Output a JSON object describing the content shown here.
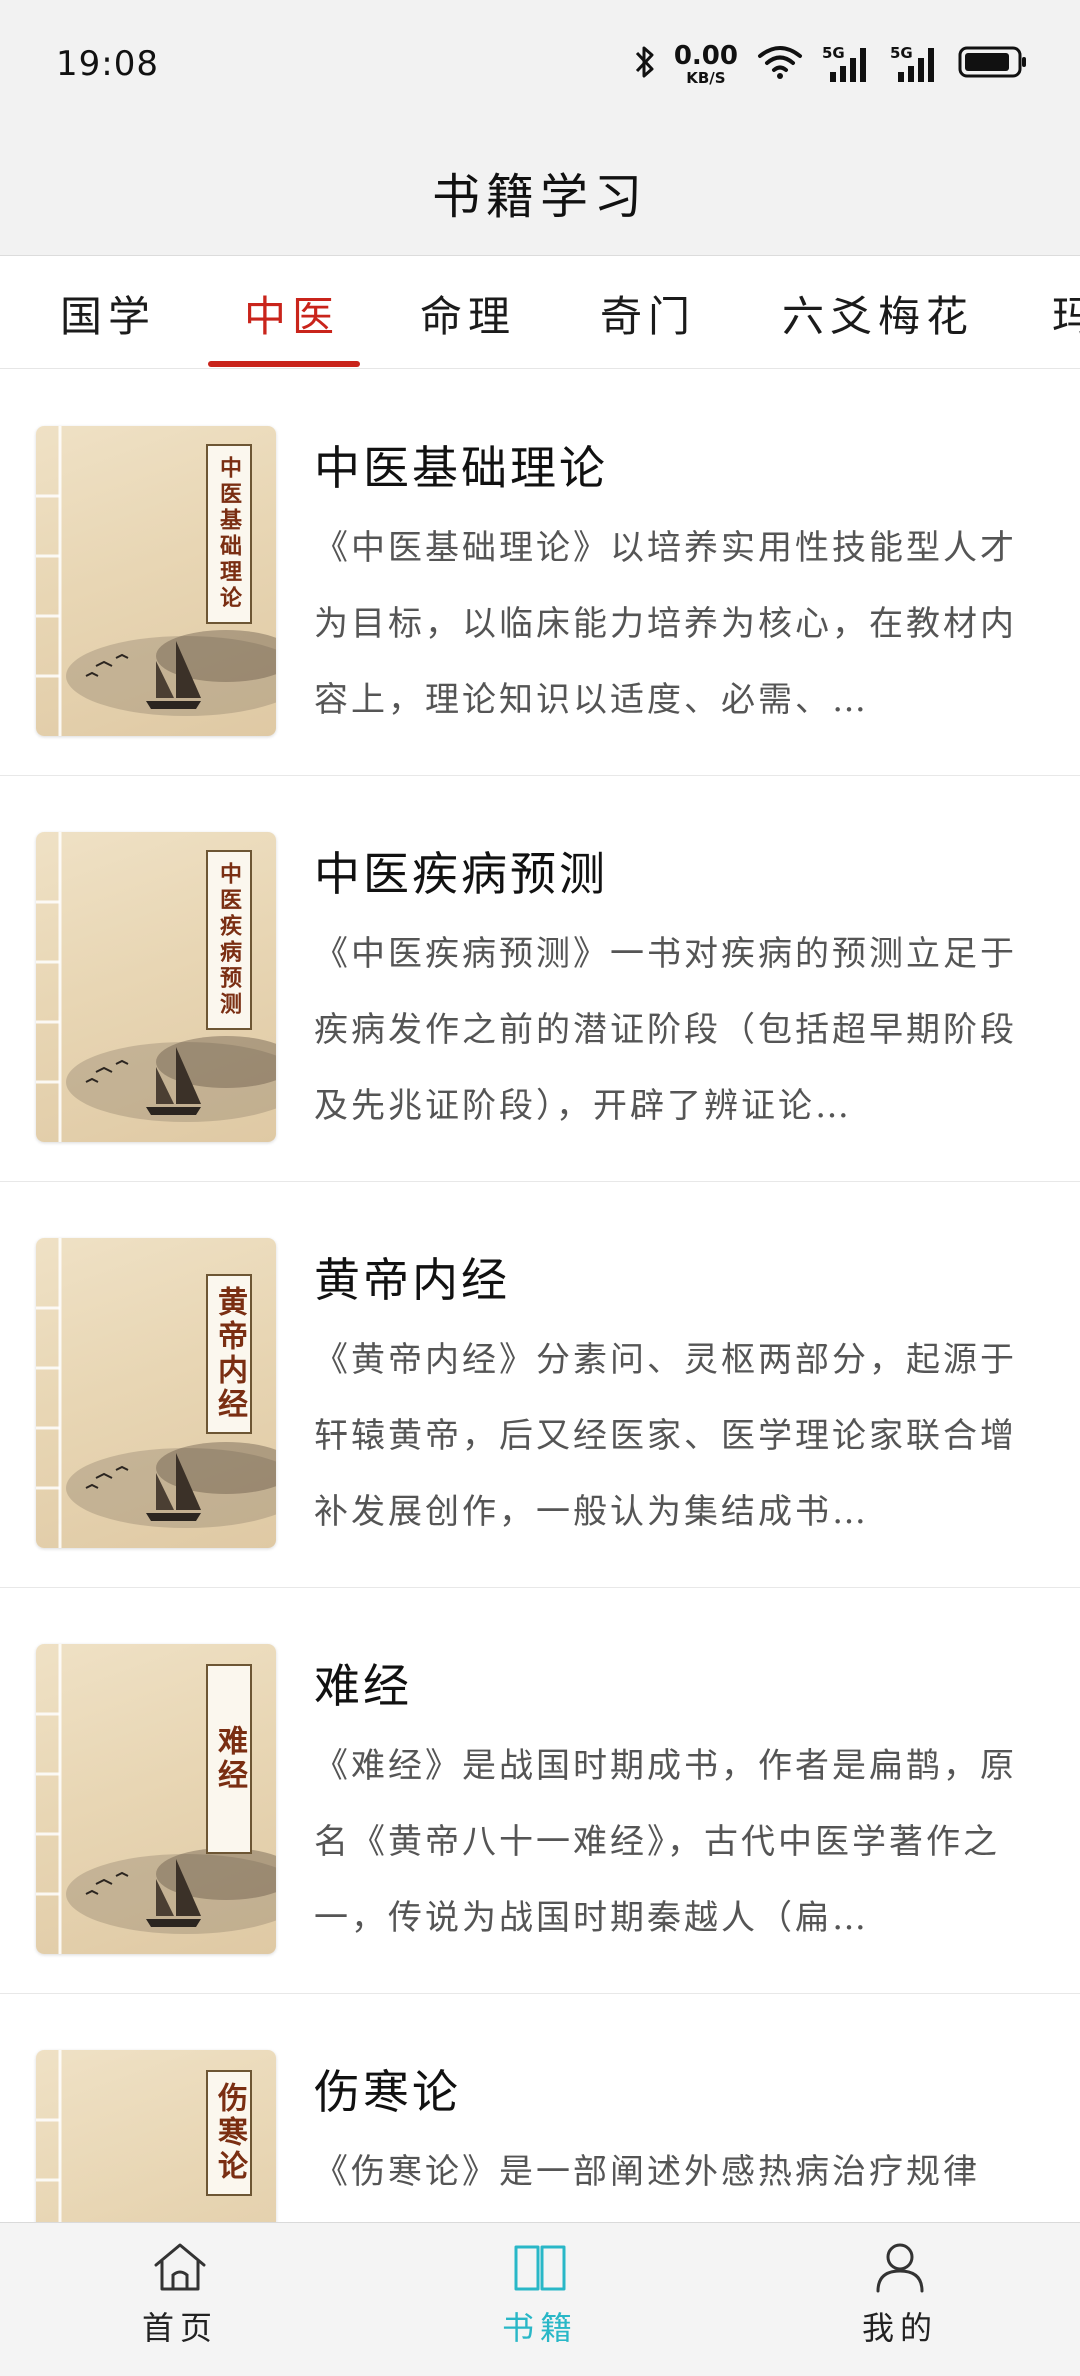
{
  "status_bar": {
    "time": "19:08",
    "net_speed_value": "0.00",
    "net_speed_unit": "KB/S",
    "signal_1": "5G",
    "signal_2": "5G",
    "icons": [
      "bluetooth-icon",
      "wifi-icon",
      "signal-icon",
      "signal-icon",
      "battery-icon"
    ]
  },
  "header": {
    "title": "书籍学习"
  },
  "tabs": [
    {
      "label": "国学",
      "active": false
    },
    {
      "label": "中医",
      "active": true
    },
    {
      "label": "命理",
      "active": false
    },
    {
      "label": "奇门",
      "active": false
    },
    {
      "label": "六爻梅花",
      "active": false
    },
    {
      "label": "玛",
      "active": false
    }
  ],
  "books": [
    {
      "cover_text": "中医基础理论",
      "title": "中医基础理论",
      "description": "《中医基础理论》以培养实用性技能型人才为目标，以临床能力培养为核心，在教材内容上，理论知识以适度、必需、…"
    },
    {
      "cover_text": "中医疾病预测",
      "title": "中医疾病预测",
      "description": "《中医疾病预测》一书对疾病的预测立足于疾病发作之前的潜证阶段（包括超早期阶段及先兆证阶段），开辟了辨证论…"
    },
    {
      "cover_text": "黄帝内经",
      "title": "黄帝内经",
      "description": "《黄帝内经》分素问、灵枢两部分，起源于轩辕黄帝，后又经医家、医学理论家联合增补发展创作，一般认为集结成书…"
    },
    {
      "cover_text": "难经",
      "title": "难经",
      "description": "《难经》是战国时期成书，作者是扁鹊，原名《黄帝八十一难经》，古代中医学著作之一，传说为战国时期秦越人（扁…"
    },
    {
      "cover_text": "伤寒论",
      "title": "伤寒论",
      "description": "《伤寒论》是一部阐述外感热病治疗规律"
    }
  ],
  "bottom_nav": [
    {
      "label": "首页",
      "icon": "home-icon",
      "active": false
    },
    {
      "label": "书籍",
      "icon": "book-icon",
      "active": true
    },
    {
      "label": "我的",
      "icon": "profile-icon",
      "active": false
    }
  ],
  "colors": {
    "accent_red": "#c9241b",
    "accent_teal": "#29b7c7",
    "bar_background": "#f2f2f2"
  }
}
